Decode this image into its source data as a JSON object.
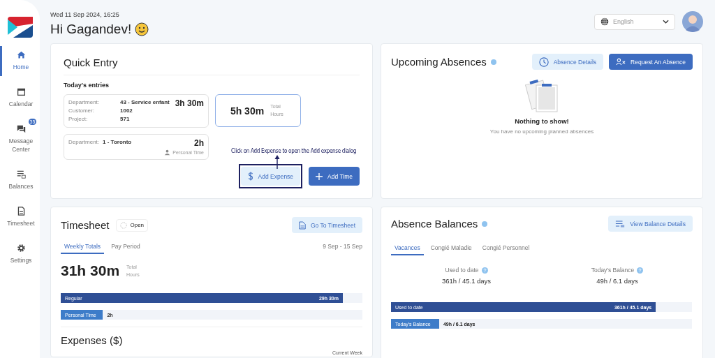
{
  "sidebar": {
    "items": [
      {
        "label": "Home",
        "selected": true
      },
      {
        "label": "Calendar",
        "selected": false
      },
      {
        "label": "Message Center",
        "selected": false,
        "badge": "35"
      },
      {
        "label": "Balances",
        "selected": false
      },
      {
        "label": "Timesheet",
        "selected": false
      },
      {
        "label": "Settings",
        "selected": false
      }
    ]
  },
  "header": {
    "datetime": "Wed 11 Sep 2024, 16:25",
    "greeting": "Hi Gagandev!",
    "language": "English"
  },
  "quick_entry": {
    "title": "Quick Entry",
    "subtitle": "Today's entries",
    "entries": [
      {
        "fields": [
          {
            "label": "Department:",
            "value": "43 - Service enfant"
          },
          {
            "label": "Customer:",
            "value": "1002"
          },
          {
            "label": "Project:",
            "value": "571"
          }
        ],
        "duration": "3h 30m"
      },
      {
        "fields": [
          {
            "label": "Department:",
            "value": "1 - Toronto"
          }
        ],
        "duration": "2h",
        "note": "Personal Time"
      }
    ],
    "total": {
      "value": "5h 30m",
      "label": "Total Hours"
    },
    "buttons": [
      {
        "label": "Add Expense",
        "kind": "secondary"
      },
      {
        "label": "Add Time",
        "kind": "primary"
      }
    ],
    "annotation": "Click on Add Expense to open the Add expense dialog"
  },
  "timesheet": {
    "title": "Timesheet",
    "status": "Open",
    "button": "Go To Timesheet",
    "tabs": [
      {
        "label": "Weekly Totals",
        "selected": true
      },
      {
        "label": "Pay Period",
        "selected": false
      }
    ],
    "range": "9 Sep - 15 Sep",
    "total": {
      "value": "31h 30m",
      "label": "Total Hours"
    },
    "bars": [
      {
        "label": "Regular",
        "value": "29h 30m",
        "level": 0.935,
        "kind": "value-inside"
      },
      {
        "label": "Personal Time",
        "value": "2h",
        "level": 0.14,
        "kind": "value-outside"
      }
    ],
    "expenses_title": "Expenses ($)",
    "expenses_period": "Current Week"
  },
  "upcoming_absences": {
    "title": "Upcoming Absences",
    "buttons": [
      {
        "label": "Absence Details",
        "kind": "secondary"
      },
      {
        "label": "Request An Absence",
        "kind": "primary"
      }
    ],
    "empty_title": "Nothing to show!",
    "empty_text": "You have no upcoming planned absences"
  },
  "absence_balances": {
    "title": "Absence Balances",
    "button": "View Balance Details",
    "tabs": [
      {
        "label": "Vacances",
        "selected": true
      },
      {
        "label": "Congié Maladie",
        "selected": false
      },
      {
        "label": "Congié Personnel",
        "selected": false
      }
    ],
    "stats": [
      {
        "label": "Used to date",
        "value": "361h / 45.1 days"
      },
      {
        "label": "Today's Balance",
        "value": "49h / 6.1 days"
      }
    ],
    "bars": [
      {
        "label": "Used to date",
        "value": "361h / 45.1 days",
        "level": 0.88,
        "kind": "value-inside"
      },
      {
        "label": "Today's Balance",
        "value": "49h / 6.1 days",
        "level": 0.16,
        "kind": "value-outside"
      }
    ]
  }
}
